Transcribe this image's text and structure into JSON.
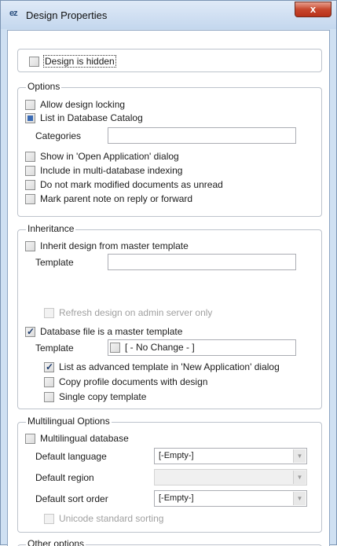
{
  "window": {
    "title": "Design Properties",
    "app_icon": "ez",
    "close_label": "x"
  },
  "top": {
    "design_hidden": "Design is hidden"
  },
  "options": {
    "legend": "Options",
    "allow_locking": "Allow design locking",
    "list_catalog": "List in Database Catalog",
    "categories_label": "Categories",
    "categories_value": "",
    "show_open_app": "Show in 'Open Application' dialog",
    "multi_db_index": "Include in multi-database indexing",
    "no_mark_unread": "Do not mark modified documents as unread",
    "mark_parent": "Mark parent note on reply or forward"
  },
  "inheritance": {
    "legend": "Inheritance",
    "inherit_design": "Inherit design from master template",
    "template_label": "Template",
    "template_value": "",
    "refresh_admin": "Refresh design on admin server only",
    "is_master": "Database file is a master template",
    "master_template_label": "Template",
    "master_template_value": "[ - No Change - ]",
    "list_advanced": "List as advanced template in 'New Application' dialog",
    "copy_profile": "Copy profile documents with design",
    "single_copy": "Single copy template"
  },
  "multilingual": {
    "legend": "Multilingual Options",
    "multilingual_db": "Multilingual database",
    "default_language_label": "Default language",
    "default_language_value": "[-Empty-]",
    "default_region_label": "Default region",
    "default_region_value": "",
    "default_sort_label": "Default sort order",
    "default_sort_value": "[-Empty-]",
    "unicode_sorting": "Unicode standard sorting"
  },
  "other": {
    "legend": "Other options"
  },
  "colors": {
    "accent": "#3a6bb5",
    "close": "#c7472d",
    "frame": "#cfe0f2"
  }
}
